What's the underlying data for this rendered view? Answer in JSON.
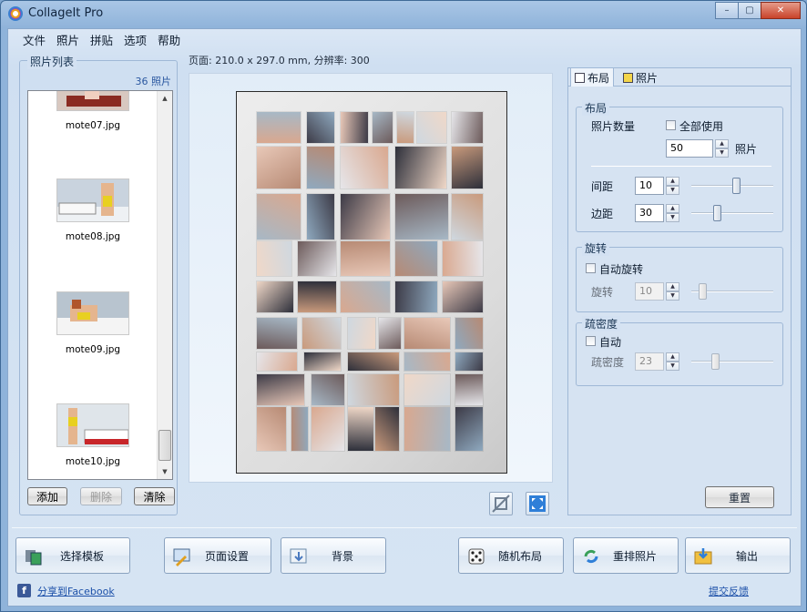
{
  "window": {
    "title": "CollageIt Pro",
    "controls": [
      "–",
      "▢",
      "✕"
    ]
  },
  "menu": [
    "文件",
    "照片",
    "拼贴",
    "选项",
    "帮助"
  ],
  "photo_list": {
    "group_label": "照片列表",
    "count": "36 照片",
    "items": [
      {
        "caption": "mote07.jpg"
      },
      {
        "caption": "mote08.jpg"
      },
      {
        "caption": "mote09.jpg"
      },
      {
        "caption": "mote10.jpg"
      }
    ],
    "add_label": "添加",
    "delete_label": "删除",
    "clear_label": "清除"
  },
  "page_info": "页面: 210.0 x 297.0 mm, 分辨率: 300",
  "colors": {
    "accent": "#3f6a97",
    "tile_palette": [
      "#d9a88f",
      "#3c3a46",
      "#e8c8b8",
      "#a7b8c6",
      "#cfd8e0",
      "#f0d8c8",
      "#6c5a5a",
      "#b78a74",
      "#8fa9bf",
      "#e6e6ea",
      "#2d2f3a",
      "#c99a7c"
    ]
  },
  "tabs": {
    "layout": "布局",
    "photos": "照片"
  },
  "layout_group": {
    "title": "布局",
    "photo_count_label": "照片数量",
    "use_all_label": "全部使用",
    "photo_count_value": "50",
    "photo_unit": "照片",
    "spacing_label": "间距",
    "spacing_value": "10",
    "spacing_level": 0.55,
    "margin_label": "边距",
    "margin_value": "30",
    "margin_level": 0.3
  },
  "rotation_group": {
    "title": "旋转",
    "auto_label": "自动旋转",
    "rotation_label": "旋转",
    "rotation_value": "10",
    "rotation_level": 0.1
  },
  "density_group": {
    "title": "疏密度",
    "auto_label": "自动",
    "density_label": "疏密度",
    "density_value": "23",
    "density_level": 0.27
  },
  "reset_label": "重置",
  "bottom_buttons": {
    "template": "选择模板",
    "page_setup": "页面设置",
    "background": "背景",
    "random_layout": "随机布局",
    "shuffle": "重排照片",
    "export": "输出"
  },
  "footer": {
    "share": "分享到Facebook",
    "feedback": "提交反馈"
  }
}
